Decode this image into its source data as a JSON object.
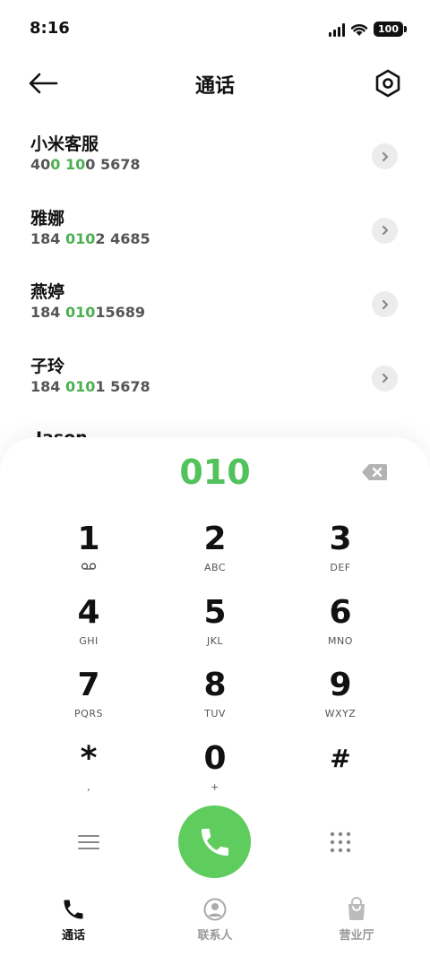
{
  "status_bar": {
    "time": "8:16",
    "battery": "100"
  },
  "header": {
    "title": "通话"
  },
  "contacts": [
    {
      "name": "小米客服",
      "number_parts": [
        "40",
        "0 10",
        "0 5678"
      ]
    },
    {
      "name": "雅娜",
      "number_parts": [
        "184 ",
        "010",
        "2 4685"
      ]
    },
    {
      "name": "燕婷",
      "number_parts": [
        "184 ",
        "010",
        "15689"
      ]
    },
    {
      "name": "子玲",
      "number_parts": [
        "184 ",
        "010",
        "1 5678"
      ]
    }
  ],
  "partial_contact": {
    "name": "Jason"
  },
  "dialer": {
    "input": "010",
    "keys": [
      {
        "digit": "1",
        "letters": ""
      },
      {
        "digit": "2",
        "letters": "ABC"
      },
      {
        "digit": "3",
        "letters": "DEF"
      },
      {
        "digit": "4",
        "letters": "GHI"
      },
      {
        "digit": "5",
        "letters": "JKL"
      },
      {
        "digit": "6",
        "letters": "MNO"
      },
      {
        "digit": "7",
        "letters": "PQRS"
      },
      {
        "digit": "8",
        "letters": "TUV"
      },
      {
        "digit": "9",
        "letters": "WXYZ"
      },
      {
        "digit": "*",
        "letters": ","
      },
      {
        "digit": "0",
        "letters": "+"
      },
      {
        "digit": "#",
        "letters": ""
      }
    ]
  },
  "nav": {
    "calls": "通话",
    "contacts": "联系人",
    "service": "营业厅"
  },
  "colors": {
    "accent": "#52c25c",
    "call_button": "#5fcd5e",
    "text": "#111111",
    "muted": "#999999"
  }
}
